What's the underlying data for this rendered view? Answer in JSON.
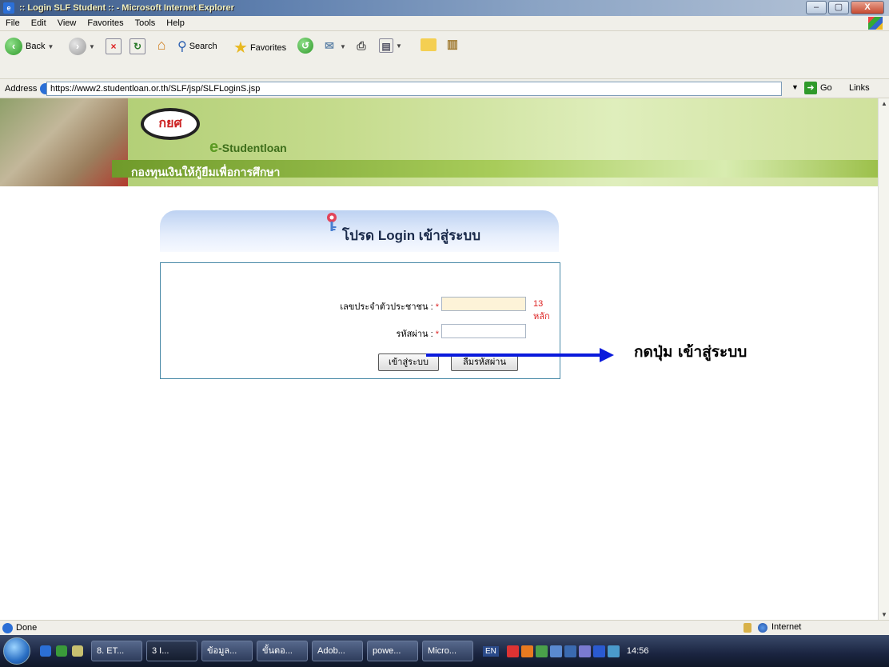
{
  "window": {
    "title": ":: Login SLF Student :: - Microsoft Internet Explorer",
    "buttons": [
      "–",
      "▢",
      "X"
    ]
  },
  "menu": [
    "File",
    "Edit",
    "View",
    "Favorites",
    "Tools",
    "Help"
  ],
  "toolbar": {
    "back": "Back",
    "search": "Search",
    "favorites": "Favorites"
  },
  "address": {
    "label": "Address",
    "url": "https://www2.studentloan.or.th/SLF/jsp/SLFLoginS.jsp",
    "go": "Go",
    "links": "Links"
  },
  "banner": {
    "logo_text": "กยศ",
    "brand_prefix": "e",
    "brand": "-Studentloan",
    "fund_name": "กองทุนเงินให้กู้ยืมเพื่อการศึกษา"
  },
  "login": {
    "title": "โปรด Login เข้าสู่ระบบ",
    "id_label": "เลขประจำตัวประชาชน :",
    "required": "*",
    "id_hint": "13 หลัก",
    "password_label": "รหัสผ่าน :",
    "login_button": "เข้าสู่ระบบ",
    "forgot_button": "ลืมรหัสผ่าน"
  },
  "annotation": "กดปุ่ม เข้าสู่ระบบ",
  "status": {
    "text": "Done",
    "zone": "Internet"
  },
  "taskbar": {
    "tasks": [
      "8. ET...",
      "3 I...",
      "ข้อมูล...",
      "ขั้นตอ...",
      "Adob...",
      "powe...",
      "Micro..."
    ],
    "language": "EN",
    "clock": "14:56"
  },
  "colors": {
    "annotation_arrow": "#0a1adc",
    "required_mark": "#dd2222",
    "login_border": "#4a8aa8"
  }
}
